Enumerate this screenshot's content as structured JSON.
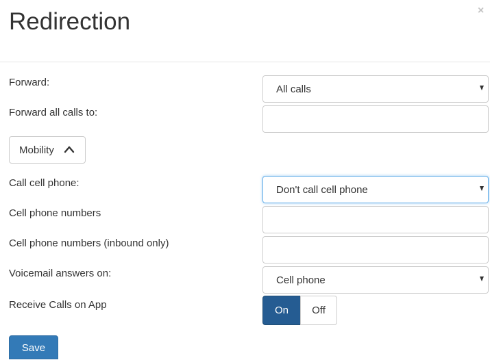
{
  "dialog": {
    "title": "Redirection",
    "close_icon": "×"
  },
  "form": {
    "forward": {
      "label": "Forward:",
      "value": "All calls"
    },
    "forward_all_calls_to": {
      "label": "Forward all calls to:",
      "value": ""
    },
    "mobility_button": {
      "label": "Mobility",
      "icon": "chevron-up-icon"
    },
    "call_cell_phone": {
      "label": "Call cell phone:",
      "value": "Don't call cell phone"
    },
    "cell_phone_numbers": {
      "label": "Cell phone numbers",
      "value": ""
    },
    "cell_phone_numbers_inbound": {
      "label": "Cell phone numbers (inbound only)",
      "value": ""
    },
    "voicemail_answers_on": {
      "label": "Voicemail answers on:",
      "value": "Cell phone"
    },
    "receive_calls_on_app": {
      "label": "Receive Calls on App",
      "on_label": "On",
      "off_label": "Off",
      "selected": "On"
    }
  },
  "footer": {
    "save_label": "Save"
  },
  "colors": {
    "primary": "#337ab7",
    "toggle_active": "#255c92",
    "focus_border": "#66afe9"
  }
}
